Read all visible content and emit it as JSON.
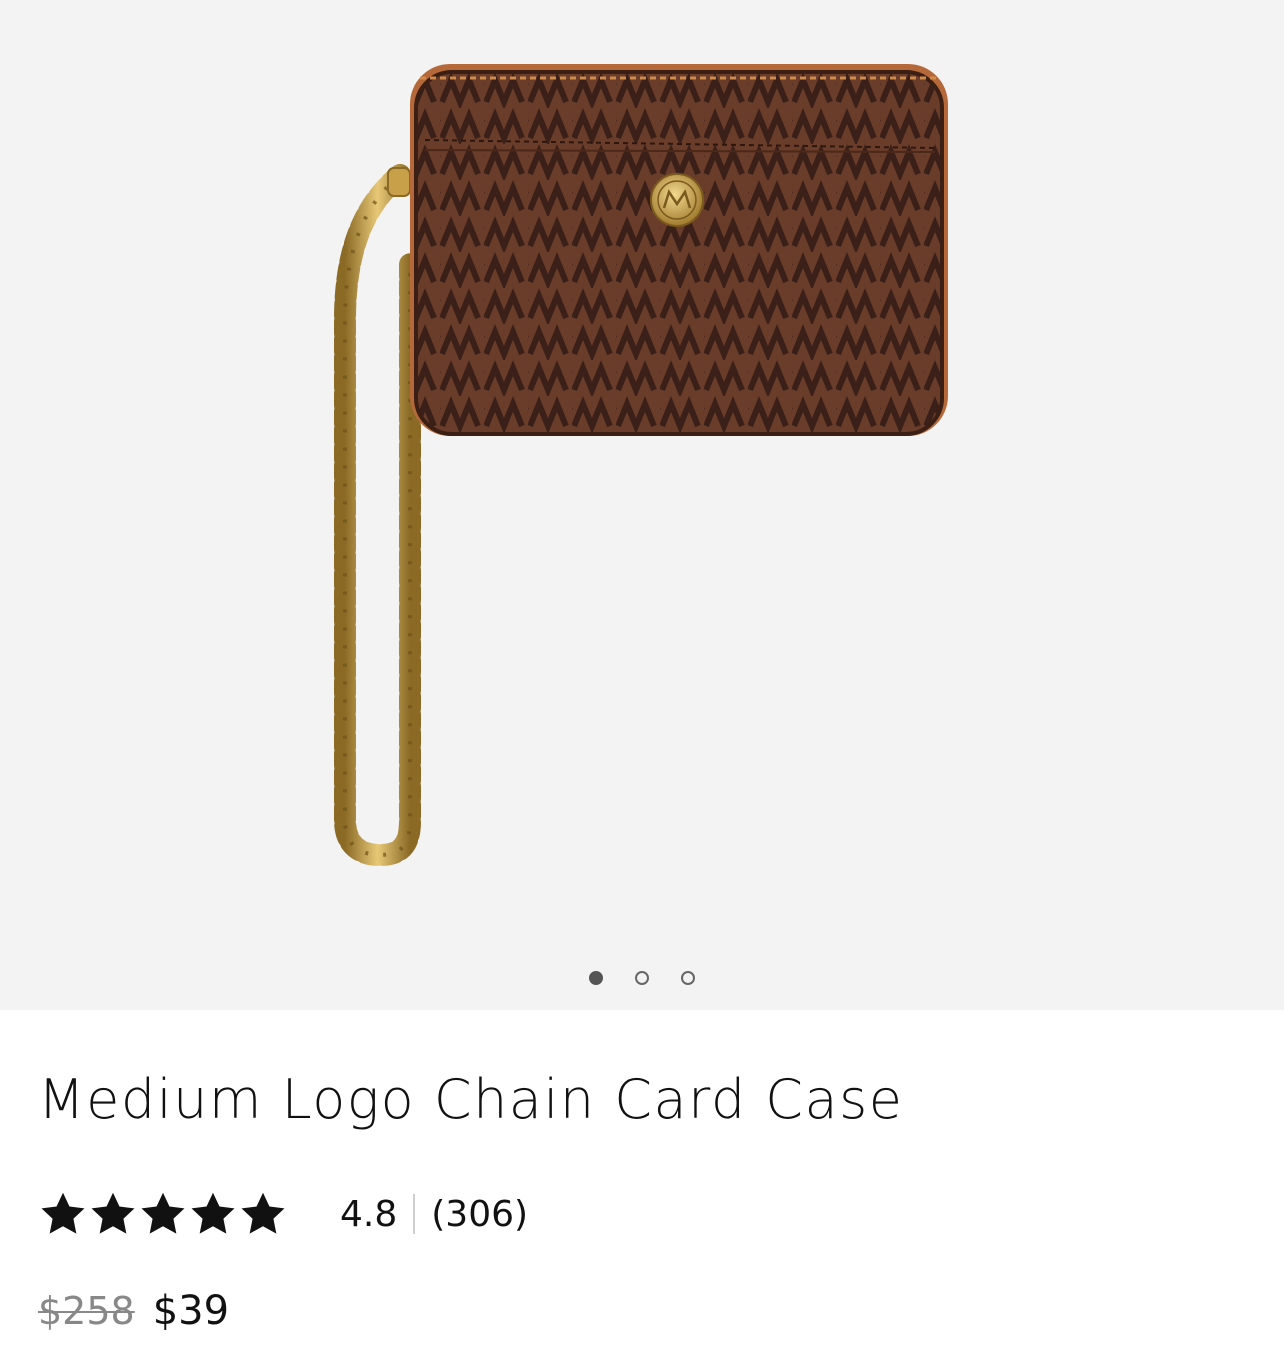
{
  "gallery": {
    "image_alt": "Medium Logo Chain Card Case",
    "slide_count": 3,
    "active_slide": 0
  },
  "product": {
    "title": "Medium Logo Chain Card Case",
    "rating": {
      "stars_filled": 5,
      "stars_total": 5,
      "value": "4.8",
      "review_count": "(306)"
    },
    "price": {
      "original": "$258",
      "sale": "$39"
    }
  },
  "colors": {
    "gallery_background": "#f3f3f3",
    "leather_brown": "#5a3425",
    "chain_gold": "#c9a04a",
    "star_color": "#111111"
  }
}
